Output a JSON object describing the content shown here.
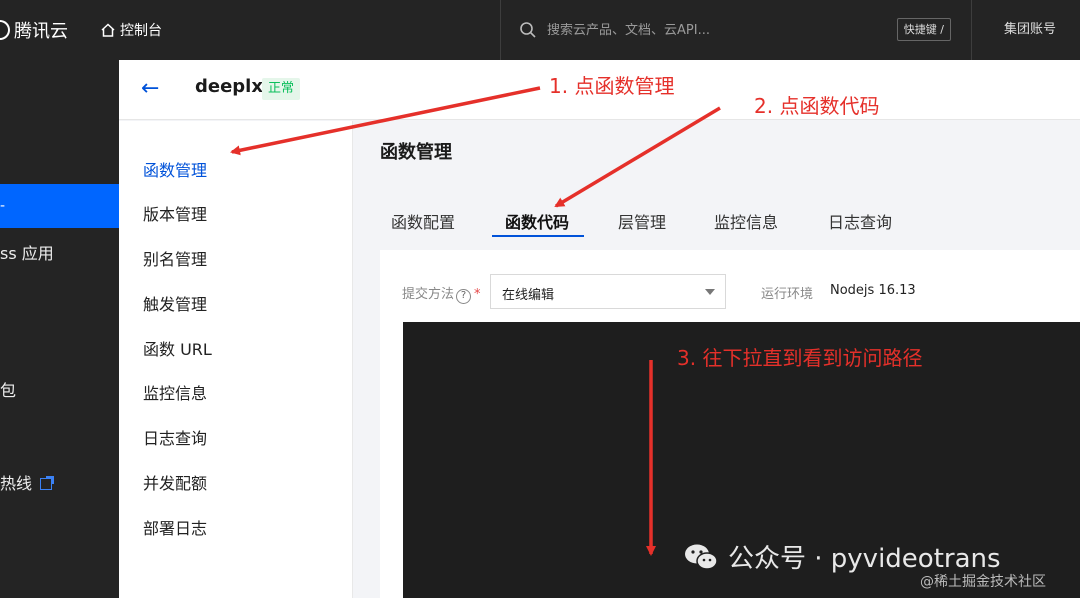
{
  "topbar": {
    "brand": "腾讯云",
    "console": "控制台",
    "search_placeholder": "搜索云产品、文档、云API...",
    "shortcut": "快捷键 /",
    "account": "集团账号"
  },
  "left_sidebar": {
    "active_indicator": "-",
    "items": [
      "ss 应用",
      "包",
      "热线"
    ]
  },
  "function_header": {
    "name": "deeplx",
    "status": "正常"
  },
  "sub_menu": {
    "items": [
      "函数管理",
      "版本管理",
      "别名管理",
      "触发管理",
      "函数 URL",
      "监控信息",
      "日志查询",
      "并发配额",
      "部署日志"
    ]
  },
  "main": {
    "title": "函数管理",
    "tabs": [
      "函数配置",
      "函数代码",
      "层管理",
      "监控信息",
      "日志查询"
    ],
    "form": {
      "submit_label": "提交方法",
      "help": "?",
      "required": "*",
      "submit_value": "在线编辑",
      "runtime_label": "运行环境",
      "runtime_value": "Nodejs 16.13"
    }
  },
  "annotations": {
    "step1": "1. 点函数管理",
    "step2": "2. 点函数代码",
    "step3": "3. 往下拉直到看到访问路径",
    "color": "#e5302a"
  },
  "watermarks": {
    "wechat": "公众号 · pyvideotrans",
    "site": "@稀土掘金技术社区"
  },
  "colors": {
    "topbar": "#242424",
    "accent": "#0052d9",
    "active_nav": "#0066ff",
    "status_green": "#0abf5b",
    "editor_bg": "#1e1e1e"
  }
}
